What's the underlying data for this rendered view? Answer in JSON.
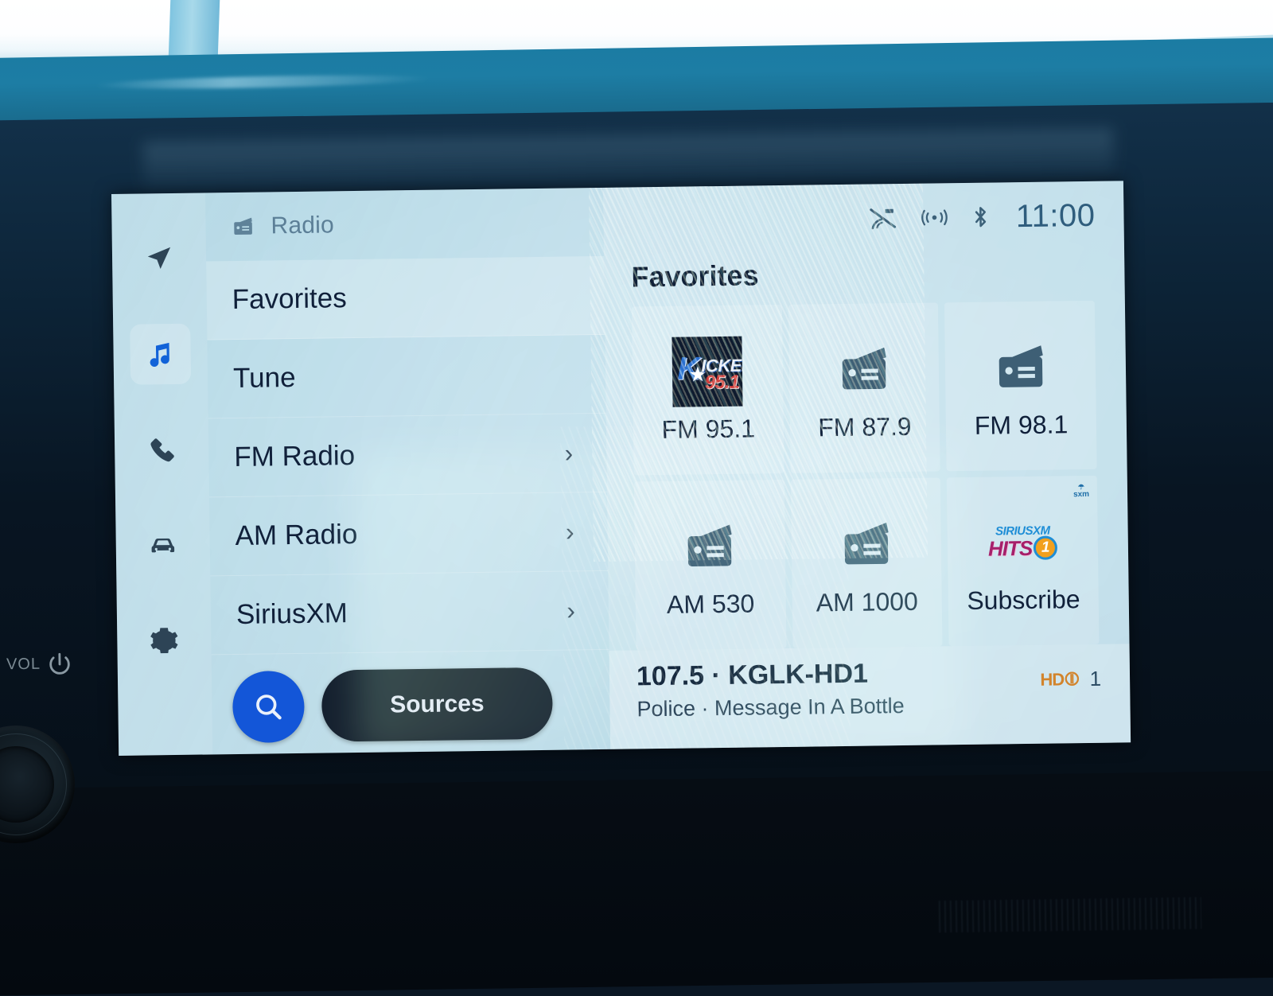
{
  "device": {
    "hardkeys": {
      "vol_label": "VOL",
      "power_icon": "power-icon"
    }
  },
  "screen": {
    "rail": {
      "items": [
        {
          "name": "navigation",
          "icon": "navigation-arrow-icon",
          "active": false
        },
        {
          "name": "media",
          "icon": "music-note-icon",
          "active": true
        },
        {
          "name": "phone",
          "icon": "phone-icon",
          "active": false
        },
        {
          "name": "vehicle",
          "icon": "car-icon",
          "active": false
        },
        {
          "name": "settings",
          "icon": "gear-icon",
          "active": false
        }
      ]
    },
    "menu": {
      "header": {
        "icon": "radio-icon",
        "title": "Radio"
      },
      "items": [
        {
          "label": "Favorites",
          "chevron": "",
          "selected": true
        },
        {
          "label": "Tune",
          "chevron": "",
          "selected": false
        },
        {
          "label": "FM Radio",
          "chevron": "›",
          "selected": false
        },
        {
          "label": "AM Radio",
          "chevron": "›",
          "selected": false
        },
        {
          "label": "SiriusXM",
          "chevron": "›",
          "selected": false
        }
      ],
      "search_icon": "search-icon",
      "sources_label": "Sources"
    },
    "status_bar": {
      "icons": [
        {
          "name": "satellite-muted-icon"
        },
        {
          "name": "wireless-broadcast-icon"
        },
        {
          "name": "bluetooth-icon"
        }
      ],
      "clock": "11:00"
    },
    "content": {
      "title": "Favorites",
      "favorites": [
        {
          "label": "FM 95.1",
          "art": "station-logo-kicker",
          "logo": {
            "k": "K",
            "rest": "ICKER",
            "star": "★",
            "num": "95.1"
          }
        },
        {
          "label": "FM 87.9",
          "art": "radio-icon"
        },
        {
          "label": "FM 98.1",
          "art": "radio-icon"
        },
        {
          "label": "AM 530",
          "art": "radio-icon"
        },
        {
          "label": "AM 1000",
          "art": "radio-icon"
        },
        {
          "label": "Subscribe",
          "art": "station-logo-siriusxm-hits1",
          "logo": {
            "top": "SiriusXM",
            "hits": "Hits",
            "one": "1",
            "badge": "sxm"
          }
        }
      ]
    },
    "now_playing": {
      "title": "107.5 · KGLK-HD1",
      "subtitle": "Police · Message In A Bottle",
      "hd": {
        "mark": "HD",
        "arc": "⦷",
        "channel": "1"
      }
    }
  },
  "colors": {
    "accent_blue": "#1356d8",
    "dark_pill": "#141f2e",
    "text_primary": "#10203a",
    "text_muted": "#5c7f97",
    "hd_orange": "#d2842c",
    "screen_bg": "#cfe8f1"
  }
}
